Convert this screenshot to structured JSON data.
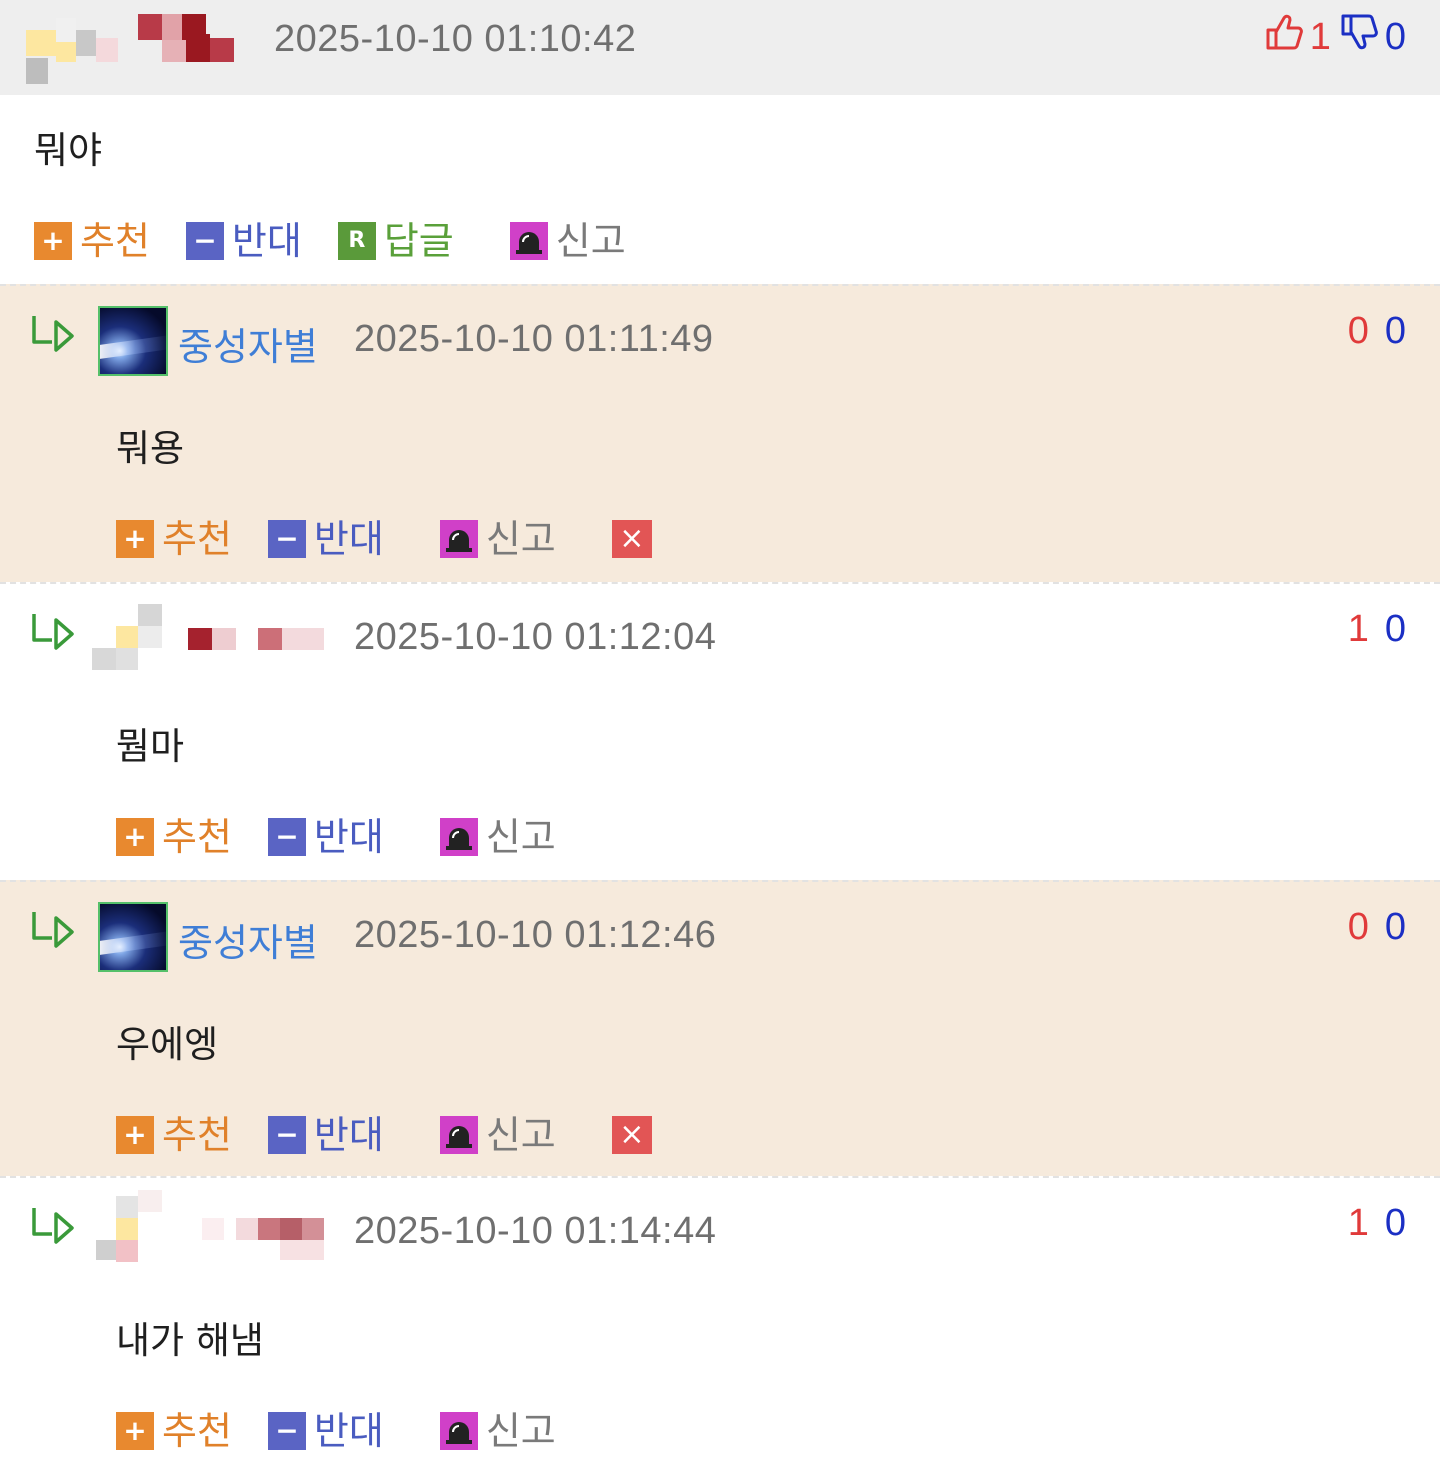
{
  "main": {
    "timestamp": "2025-10-10 01:10:42",
    "up_count": "1",
    "down_count": "0",
    "text": "뭐야",
    "actions": {
      "recommend": "추천",
      "oppose": "반대",
      "reply": "답글",
      "report": "신고"
    }
  },
  "replies": [
    {
      "author": "중성자별",
      "timestamp": "2025-10-10 01:11:49",
      "up": "0",
      "down": "0",
      "text": "뭐용",
      "highlighted": true,
      "has_delete": true
    },
    {
      "author": "",
      "timestamp": "2025-10-10 01:12:04",
      "up": "1",
      "down": "0",
      "text": "뭠마",
      "highlighted": false,
      "has_delete": false
    },
    {
      "author": "중성자별",
      "timestamp": "2025-10-10 01:12:46",
      "up": "0",
      "down": "0",
      "text": "우에엥",
      "highlighted": true,
      "has_delete": true
    },
    {
      "author": "",
      "timestamp": "2025-10-10 01:14:44",
      "up": "1",
      "down": "0",
      "text": "내가 해냄",
      "highlighted": false,
      "has_delete": false
    }
  ],
  "labels": {
    "recommend": "추천",
    "oppose": "반대",
    "report": "신고",
    "delete": "×"
  },
  "colors": {
    "highlight_bg": "#f6eadc",
    "header_bg": "#eeeeee",
    "recommend": "#e0812a",
    "oppose": "#4a5cc0",
    "reply": "#5aa03a",
    "up": "#e03a3a",
    "down": "#1b2fc4",
    "nick": "#3f7ed6"
  },
  "icons": {
    "thumb_up": "thumbs-up-icon",
    "thumb_down": "thumbs-down-icon",
    "reply_arrow": "reply-arrow-icon",
    "siren": "siren-icon"
  }
}
